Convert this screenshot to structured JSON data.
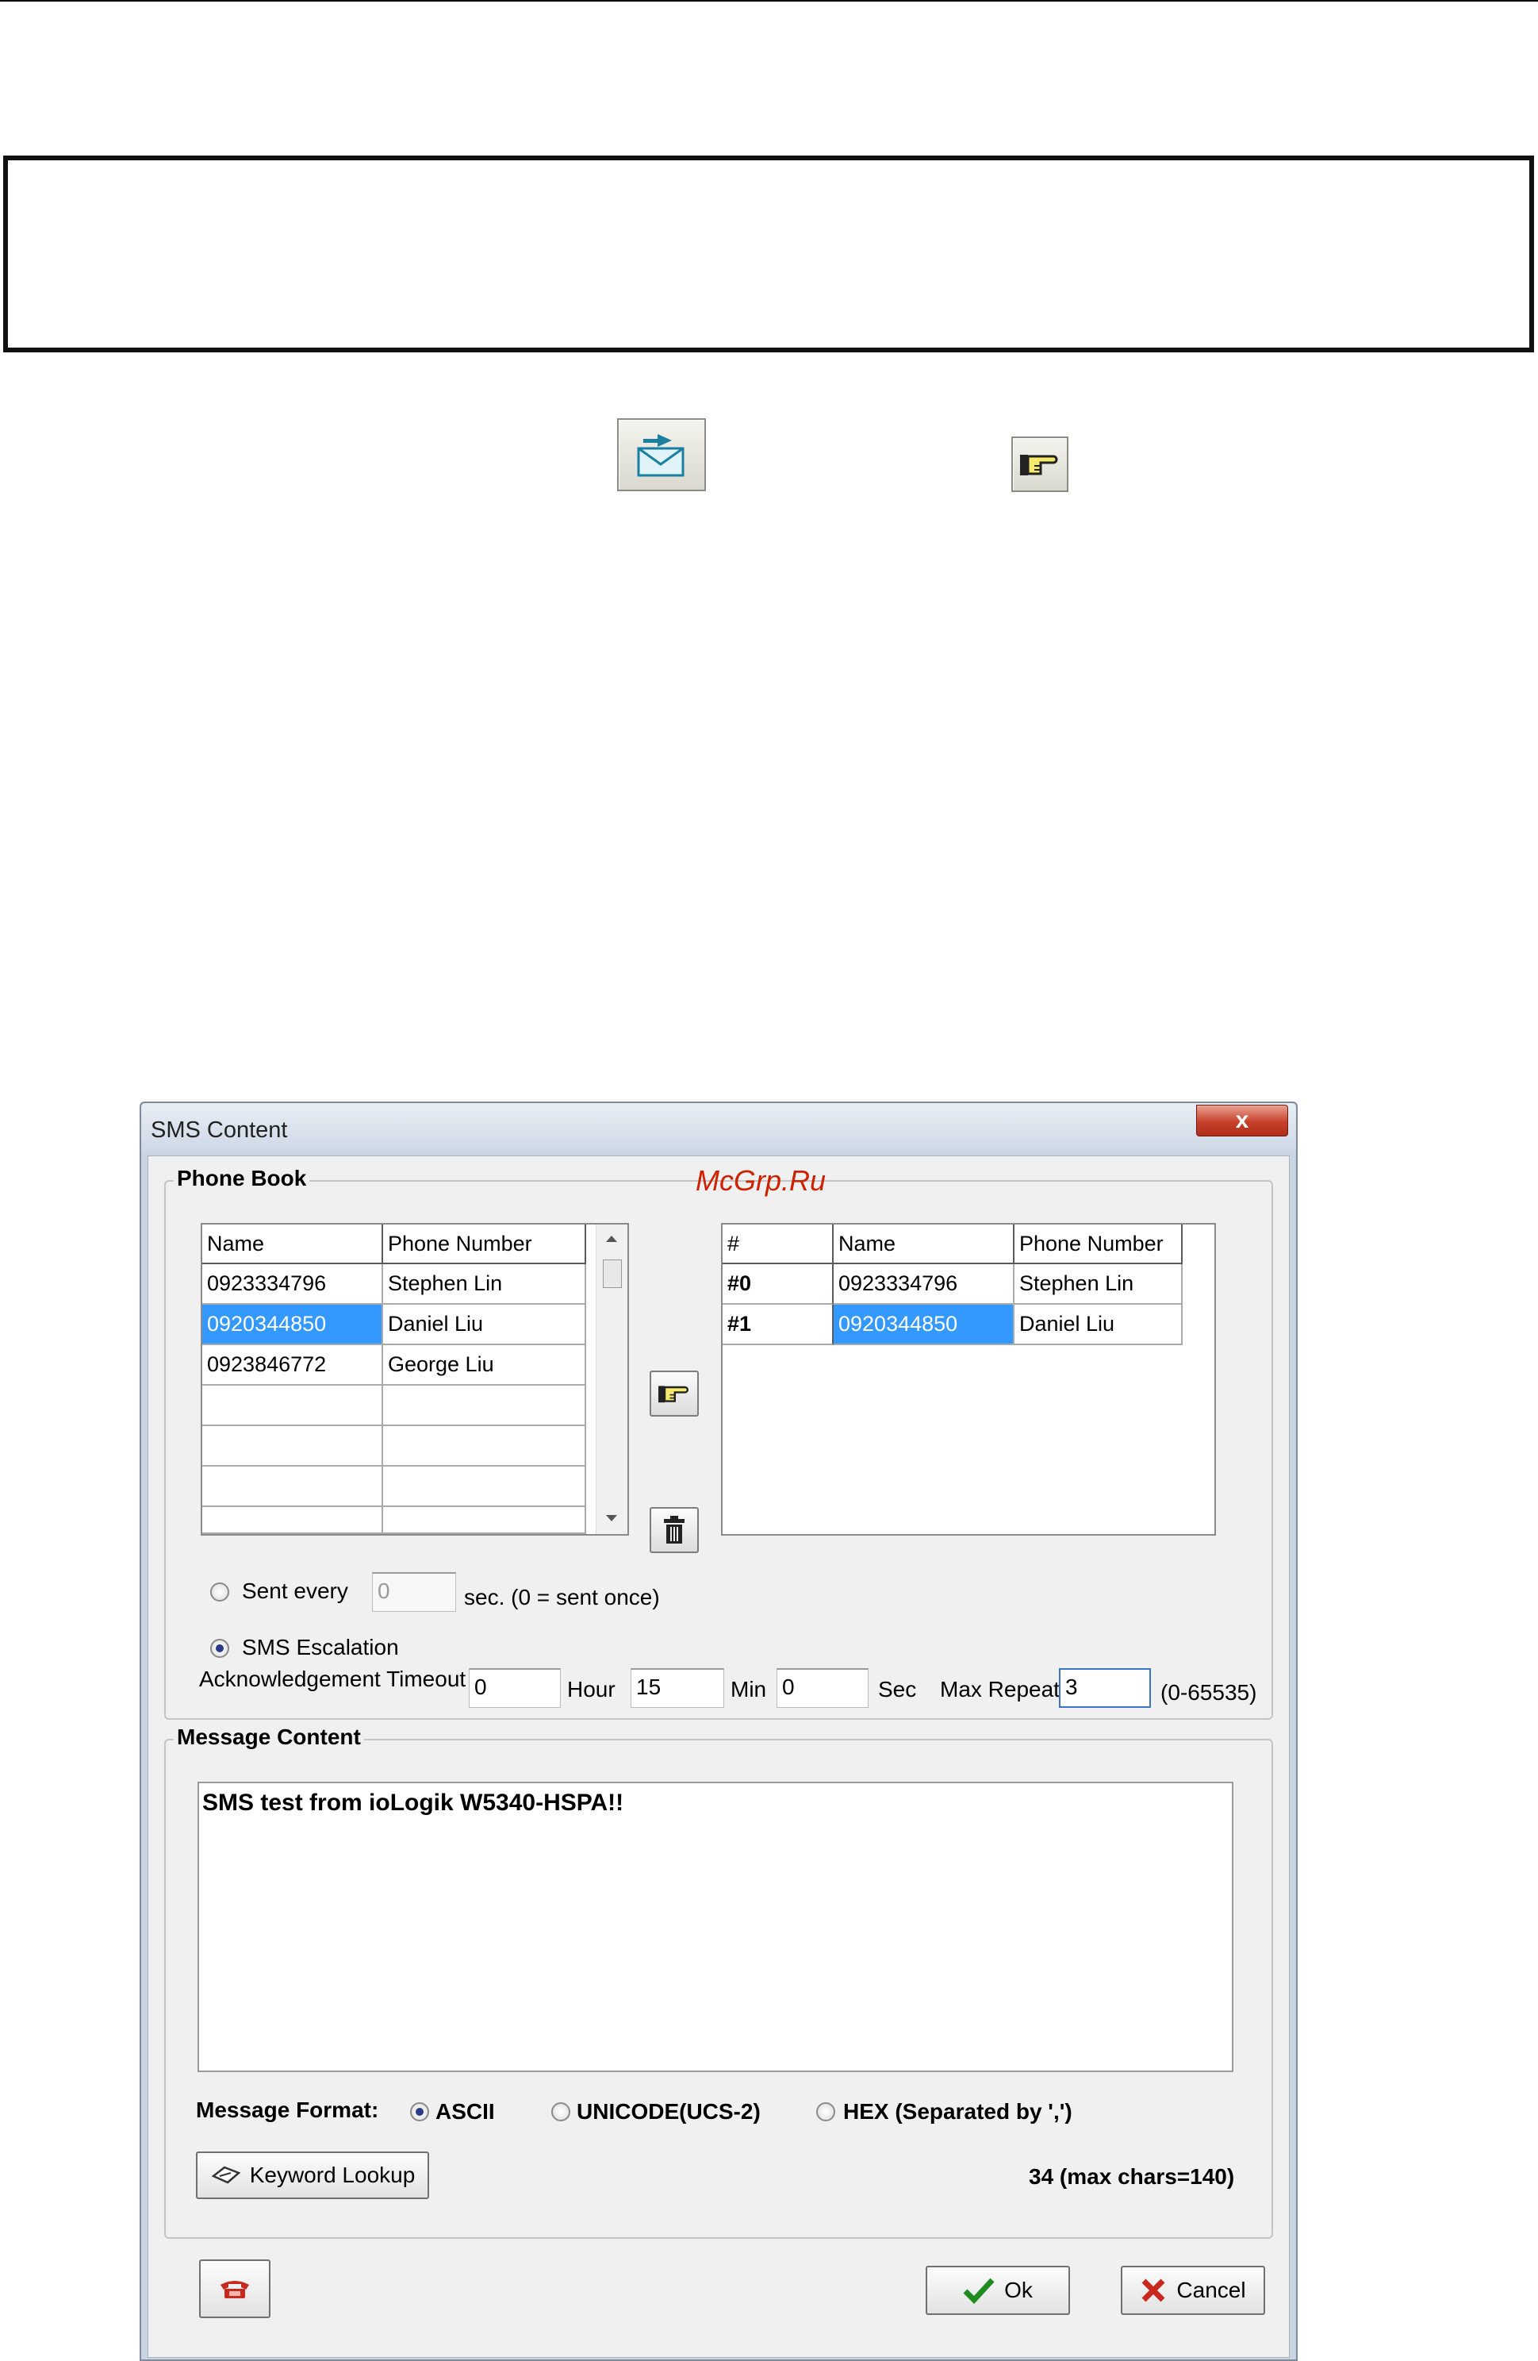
{
  "dialog": {
    "title": "SMS Content",
    "close_glyph": "x",
    "watermark": "McGrp.Ru",
    "phone_book": {
      "title": "Phone Book",
      "left_columns": [
        "Name",
        "Phone Number"
      ],
      "left_rows": [
        {
          "name": "0923334796",
          "phone": "Stephen Lin",
          "selected": false
        },
        {
          "name": "0920344850",
          "phone": "Daniel Liu",
          "selected": true
        },
        {
          "name": "0923846772",
          "phone": "George Liu",
          "selected": false
        }
      ],
      "right_columns": [
        "#",
        "Name",
        "Phone Number"
      ],
      "right_rows": [
        {
          "num": "#0",
          "name": "0923334796",
          "phone": "Stephen Lin",
          "selected": false
        },
        {
          "num": "#1",
          "name": "0920344850",
          "phone": "Daniel Liu",
          "selected": true
        }
      ]
    },
    "sent_every": {
      "label": "Sent every",
      "value": "0",
      "suffix": "sec. (0 = sent once)",
      "checked": false
    },
    "escalation": {
      "label": "SMS Escalation",
      "checked": true,
      "ack_label": "Acknowledgement Timeout",
      "hour_value": "0",
      "hour_label": "Hour",
      "min_value": "15",
      "min_label": "Min",
      "sec_value": "0",
      "sec_label": "Sec",
      "max_repeat_label": "Max Repeat",
      "max_repeat_value": "3",
      "range": "(0-65535)"
    },
    "message": {
      "title": "Message Content",
      "text": "SMS test from ioLogik W5340-HSPA!!",
      "format_label": "Message Format:",
      "formats": [
        {
          "label": "ASCII",
          "checked": true
        },
        {
          "label": "UNICODE(UCS-2)",
          "checked": false
        },
        {
          "label": "HEX (Separated by ',')",
          "checked": false
        }
      ],
      "keyword_button": "Keyword Lookup",
      "char_count": "34 (max chars=140)"
    },
    "buttons": {
      "ok": "Ok",
      "cancel": "Cancel"
    }
  },
  "colors": {
    "selection": "#3399ff",
    "watermark": "#cc2200",
    "ok_check": "#1e8c1e",
    "cancel_x": "#c8281e"
  }
}
